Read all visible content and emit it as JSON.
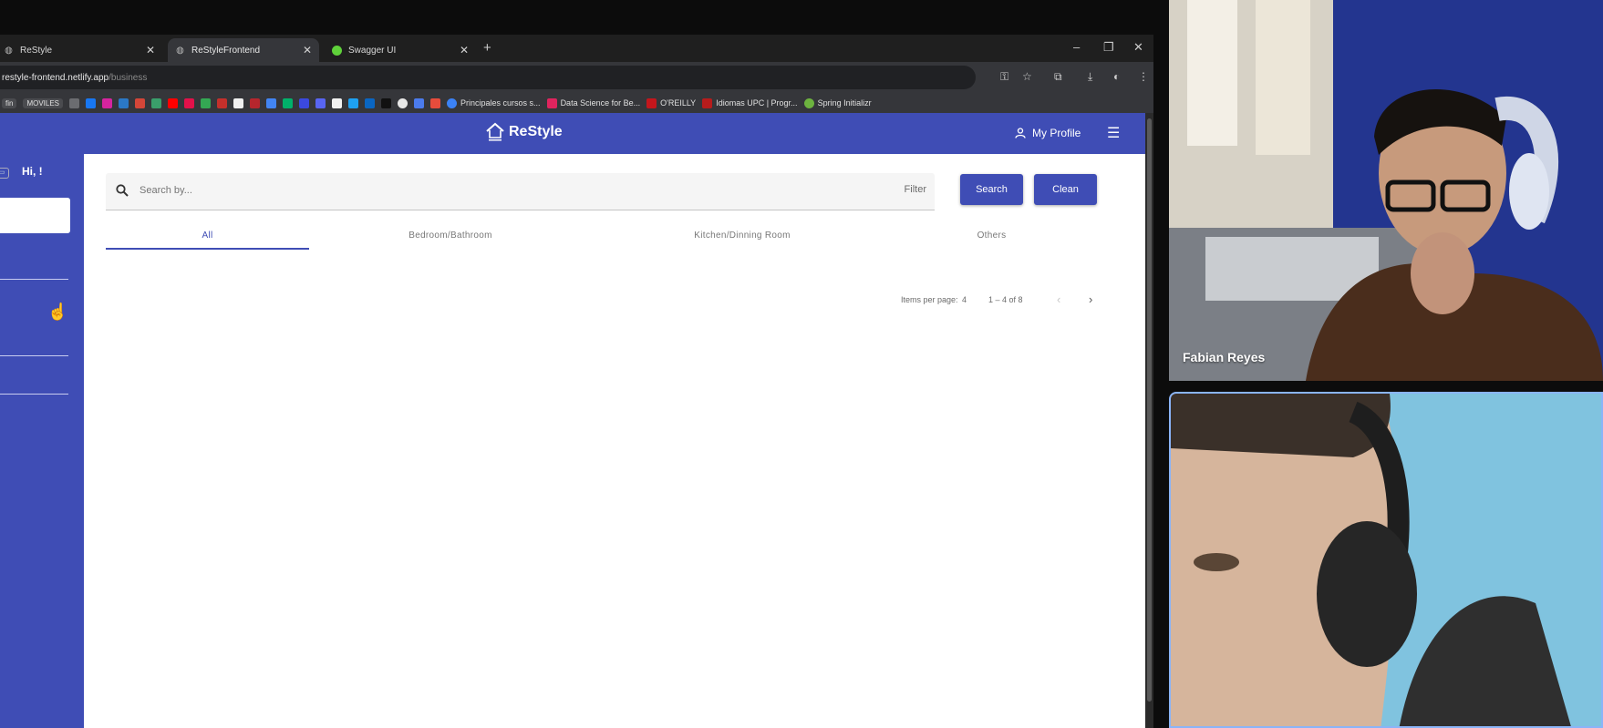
{
  "browser": {
    "tabs": [
      {
        "title": "ReStyle",
        "active": false
      },
      {
        "title": "ReStyleFrontend",
        "active": true
      },
      {
        "title": "Swagger UI",
        "active": false
      }
    ],
    "new_tab": "+",
    "url_host": "restyle-frontend.netlify.app",
    "url_path": "/business",
    "bookmarks": {
      "movies": "MOVILES",
      "items": [
        "Principales cursos s...",
        "Data Science for Be...",
        "O'REILLY",
        "Idiomas UPC | Progr...",
        "Spring Initializr"
      ]
    }
  },
  "app": {
    "brand": "ReStyle",
    "profile_label": "My Profile",
    "greeting": "Hi, !",
    "search": {
      "placeholder": "Search by...",
      "filter_label": "Filter"
    },
    "buttons": {
      "search": "Search",
      "clean": "Clean"
    },
    "tabs": [
      "All",
      "Bedroom/Bathroom",
      "Kitchen/Dinning Room",
      "Others"
    ],
    "paginator": {
      "items_per_page_label": "Items per page:",
      "items_per_page": "4",
      "range": "1 – 4 of 8"
    }
  },
  "call": {
    "participants": [
      {
        "name": "Fabian Reyes"
      }
    ]
  },
  "colors": {
    "primary": "#3f4db5",
    "chrome_dark": "#202124",
    "tab_active": "#35363a"
  }
}
